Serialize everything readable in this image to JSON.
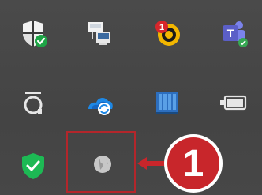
{
  "tray": {
    "icons": [
      {
        "name": "windows-security-icon",
        "state": "ok"
      },
      {
        "name": "network-connection-icon"
      },
      {
        "name": "notification-app-icon",
        "badge": "1"
      },
      {
        "name": "microsoft-teams-icon"
      },
      {
        "name": "app-a-icon"
      },
      {
        "name": "onedrive-sync-icon"
      },
      {
        "name": "storage-manager-icon"
      },
      {
        "name": "battery-icon"
      },
      {
        "name": "security-shield-check-icon"
      },
      {
        "name": "globe-icon"
      }
    ]
  },
  "annotation": {
    "callout_number": "1",
    "highlight_color": "#b3262b"
  },
  "colors": {
    "tray_bg": "#464646",
    "accent_red": "#c8262b",
    "shield_green": "#1db954",
    "teams_purple": "#5b5fc7",
    "onedrive_blue": "#1e88e5"
  }
}
